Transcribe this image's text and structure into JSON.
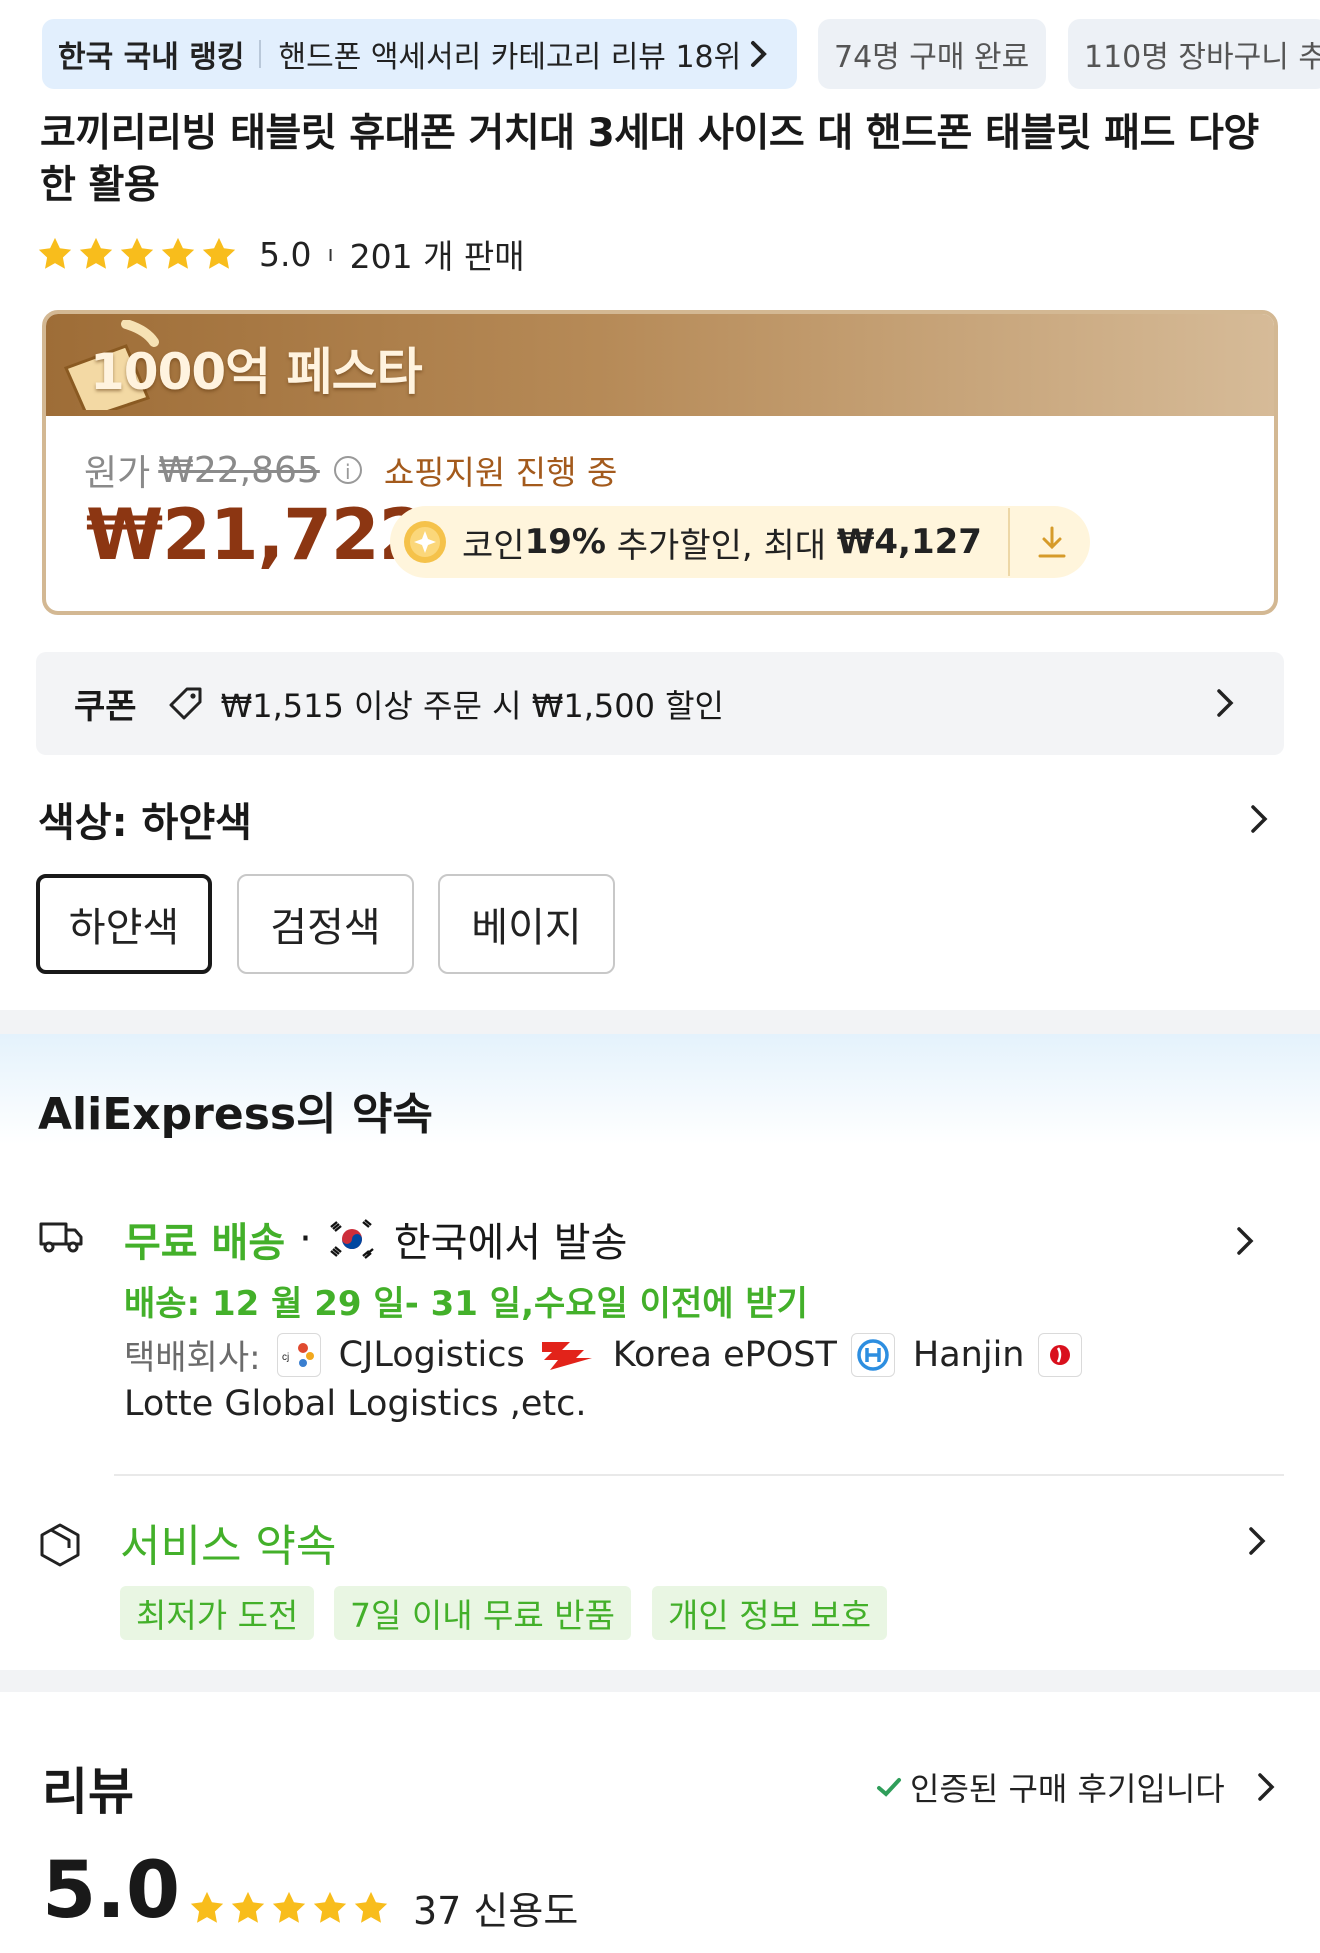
{
  "ranking": {
    "label": "한국 국내 랭킹",
    "detail": "핸드폰 액세서리 카테고리 리뷰 18위",
    "purchased": "74명 구매 완료",
    "carted": "110명 장바구니 추"
  },
  "product": {
    "title": "코끼리리빙 태블릿 휴대폰 거치대 3세대 사이즈 대 핸드폰 태블릿 패드 다양한 활용",
    "rating": "5.0",
    "rating_sep": "ı",
    "sold": "201 개 판매",
    "star_color": "#f8bd1c"
  },
  "price": {
    "festival": "1000억 페스타",
    "original_label": "원가",
    "original_price": "₩22,865",
    "info": "i",
    "support_text": "쇼핑지원 진행 중",
    "current_price": "₩21,722",
    "coin_prefix": "코인 ",
    "coin_percent": "19%",
    "coin_middle": " 추가할인, 최대 ",
    "coin_max": "₩4,127",
    "price_color": "#8c3612"
  },
  "coupon": {
    "title": "쿠폰",
    "text": "₩1,515 이상 주문 시 ₩1,500 할인"
  },
  "color": {
    "title": "색상: 하얀색",
    "options": [
      "하얀색",
      "검정색",
      "베이지"
    ],
    "selected_index": 0
  },
  "promise": {
    "title": "AliExpress의 약속",
    "free_shipping": "무료 배송",
    "dot": "·",
    "ship_from": "한국에서 발송",
    "delivery_date": "배송: 12 월 29 일- 31 일,수요일 이전에 받기",
    "courier_label": "택배회사:",
    "couriers": [
      "CJLogistics",
      "Korea ePOST",
      "Hanjin"
    ],
    "courier_extra": "Lotte Global Logistics ,etc.",
    "service_title": "서비스 약속",
    "service_tags": [
      "최저가 도전",
      "7일 이내 무료 반품",
      "개인 정보 보호"
    ],
    "accent_color": "#43b02a"
  },
  "review": {
    "title": "리뷰",
    "verified": "인증된 구매 후기입니다",
    "score": "5.0",
    "count_text": "37 신용도"
  }
}
